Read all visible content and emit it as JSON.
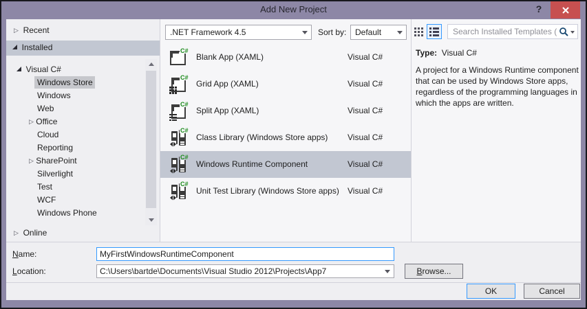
{
  "window": {
    "title": "Add New Project",
    "help_label": "?"
  },
  "toolbar": {
    "framework_combo_value": ".NET Framework 4.5",
    "sort_label": "Sort by:",
    "sort_combo_value": "Default",
    "search_placeholder": "Search Installed Templates (C"
  },
  "tree": {
    "items": [
      {
        "label": "Recent",
        "level": 0,
        "arrow": "collapsed"
      },
      {
        "label": "Installed",
        "level": 0,
        "arrow": "expanded",
        "selected": true
      },
      {
        "label": "Visual C#",
        "level": 1,
        "arrow": "expanded"
      },
      {
        "label": "Windows Store",
        "level": 2,
        "selected": true
      },
      {
        "label": "Windows",
        "level": 2
      },
      {
        "label": "Web",
        "level": 2
      },
      {
        "label": "Office",
        "level": 2,
        "arrow": "collapsed"
      },
      {
        "label": "Cloud",
        "level": 2
      },
      {
        "label": "Reporting",
        "level": 2
      },
      {
        "label": "SharePoint",
        "level": 2,
        "arrow": "collapsed"
      },
      {
        "label": "Silverlight",
        "level": 2
      },
      {
        "label": "Test",
        "level": 2
      },
      {
        "label": "WCF",
        "level": 2
      },
      {
        "label": "Windows Phone",
        "level": 2
      },
      {
        "label": "Online",
        "level": 0,
        "arrow": "collapsed"
      }
    ]
  },
  "templates": {
    "selected_index": 4,
    "items": [
      {
        "name": "Blank App (XAML)",
        "language": "Visual C#",
        "icon": "blank-app-icon"
      },
      {
        "name": "Grid App (XAML)",
        "language": "Visual C#",
        "icon": "grid-app-icon"
      },
      {
        "name": "Split App (XAML)",
        "language": "Visual C#",
        "icon": "split-app-icon"
      },
      {
        "name": "Class Library (Windows Store apps)",
        "language": "Visual C#",
        "icon": "class-library-icon"
      },
      {
        "name": "Windows Runtime Component",
        "language": "Visual C#",
        "icon": "windows-runtime-component-icon"
      },
      {
        "name": "Unit Test Library (Windows Store apps)",
        "language": "Visual C#",
        "icon": "unit-test-library-icon"
      }
    ]
  },
  "details": {
    "type_label": "Type:",
    "type_value": "Visual C#",
    "description": "A project for a Windows Runtime component that can be used by Windows Store apps, regardless of the programming languages in which the apps are written."
  },
  "form": {
    "name_label_key": "N",
    "name_label_rest": "ame:",
    "name_value": "MyFirstWindowsRuntimeComponent",
    "location_label_key": "L",
    "location_label_rest": "ocation:",
    "location_value": "C:\\Users\\bartde\\Documents\\Visual Studio 2012\\Projects\\App7",
    "browse_label_key": "B",
    "browse_label_rest": "rowse...",
    "ok_label": "OK",
    "cancel_label": "Cancel"
  },
  "colors": {
    "frame_purple": "#8d87a6",
    "close_red": "#c75050",
    "accent_blue": "#3399ff",
    "selection_blue_gray": "#c2c7d2",
    "inactive_selection_gray": "#c6c7cc",
    "dialog_bg": "#efeff2",
    "list_bg": "#f6f6f8",
    "csharp_green": "#1a8a1a"
  }
}
